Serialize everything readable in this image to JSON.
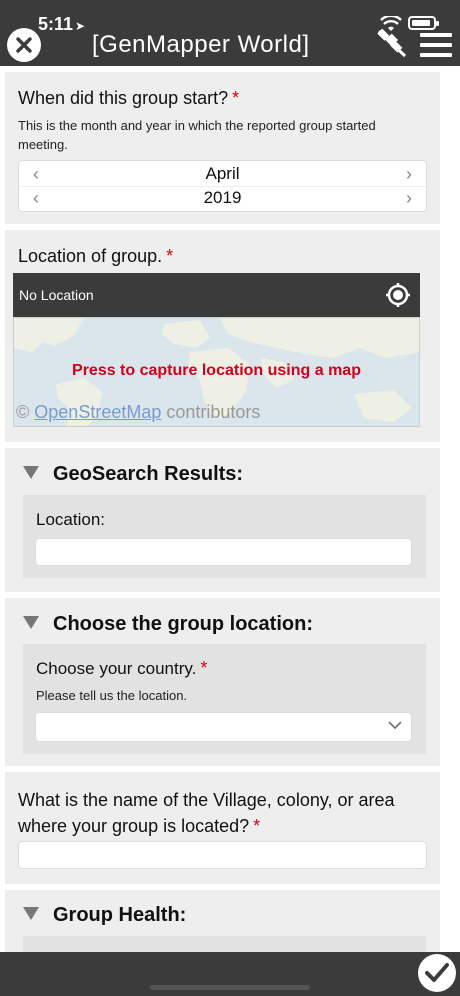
{
  "status": {
    "time": "5:11"
  },
  "header": {
    "title": "[GenMapper World]"
  },
  "group_start": {
    "label": "When did this group start?",
    "required": "*",
    "help": "This is the month and year in which the reported group started meeting.",
    "month": "April",
    "year": "2019"
  },
  "location": {
    "label": "Location of group.",
    "required": "*",
    "status": "No Location",
    "map_cta": "Press to capture location using a map",
    "attribution_symbol": "©",
    "attribution_link": "OpenStreetMap",
    "attribution_suffix": "contributors"
  },
  "geosearch": {
    "title": "GeoSearch Results:",
    "location_label": "Location:",
    "location_value": ""
  },
  "choose_location": {
    "title": "Choose the group location:",
    "country_label": "Choose your country.",
    "required": "*",
    "help": "Please tell us the location.",
    "country_value": ""
  },
  "village": {
    "label": "What is the name of the Village, colony, or area where your group is located?",
    "required": "*",
    "value": ""
  },
  "group_health": {
    "title": "Group Health:"
  },
  "icons": [
    "close-icon",
    "wifi-icon",
    "battery-icon",
    "satellite-off-icon",
    "menu-icon",
    "locate-icon",
    "triangle-down-icon",
    "chevron-left-icon",
    "chevron-right-icon",
    "chevron-down-icon",
    "check-icon"
  ],
  "colors": {
    "header_bg": "#3b3b3b",
    "required": "#dd0000",
    "map_cta": "#d3001b",
    "card_bg": "#eeeeee"
  }
}
